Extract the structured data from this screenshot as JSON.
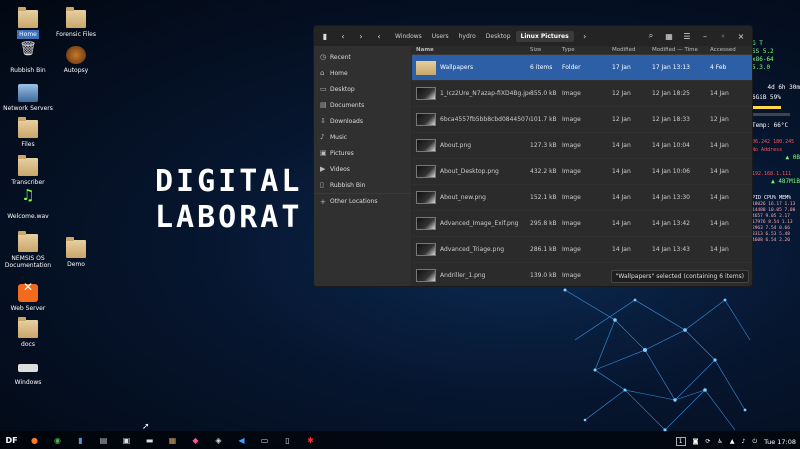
{
  "wallpaper": {
    "line1": "DIGITAL F",
    "line2": "LABORAT"
  },
  "desktop_icons": [
    {
      "label": "Home",
      "icon": "folder-icon",
      "selected": true
    },
    {
      "label": "Forensic Files",
      "icon": "folder-icon"
    },
    {
      "label": "Rubbish Bin",
      "icon": "trash-icon"
    },
    {
      "label": "Autopsy",
      "icon": "dog-icon"
    },
    {
      "label": "Network Servers",
      "icon": "network-icon"
    },
    {
      "label": "Files",
      "icon": "folder-icon"
    },
    {
      "label": "Transcriber",
      "icon": "folder-icon"
    },
    {
      "label": "Welcome.wav",
      "icon": "music-icon"
    },
    {
      "label": "NEMSIS OS Documentation",
      "icon": "folder-icon"
    },
    {
      "label": "Demo",
      "icon": "folder-icon"
    },
    {
      "label": "Web Server",
      "icon": "xampp-icon"
    },
    {
      "label": "docs",
      "icon": "folder-icon"
    },
    {
      "label": "Windows",
      "icon": "drive-icon"
    }
  ],
  "conky": {
    "l1": "G T",
    "l2": "SS 5.2",
    "l3": "x86-64",
    "l4": "5.3.0",
    "uptime": "4d 6h 30m",
    "ram": "6GiB 59%",
    "temp": "Temp: 66°C",
    "net_up_a": "06.242 180.245",
    "net_up_b": "No Address",
    "net_up_c": "▲ 0B",
    "net_dn_a": "192.168.1.111",
    "net_dn_b": "▲ 487MiB",
    "proc_header": "PID  CPU%  MEM%",
    "procs": [
      "18026 16.17 1.13",
      "14488 10.05 7.00",
      "4657  9.05 2.17",
      "17976 8.54 1.13",
      "2963  7.54 0.66",
      "3313  6.53 5.48",
      "4608  6.54 2.20"
    ]
  },
  "window": {
    "path": [
      "Windows",
      "Users",
      "hydro",
      "Desktop",
      "Linux Pictures"
    ],
    "sidebar": [
      {
        "label": "Recent",
        "icon": "clock-icon"
      },
      {
        "label": "Home",
        "icon": "home-icon"
      },
      {
        "label": "Desktop",
        "icon": "desktop-icon"
      },
      {
        "label": "Documents",
        "icon": "document-icon"
      },
      {
        "label": "Downloads",
        "icon": "download-icon"
      },
      {
        "label": "Music",
        "icon": "music-icon"
      },
      {
        "label": "Pictures",
        "icon": "picture-icon"
      },
      {
        "label": "Videos",
        "icon": "video-icon"
      },
      {
        "label": "Rubbish Bin",
        "icon": "trash-icon"
      },
      {
        "label": "Other Locations",
        "icon": "plus-icon"
      }
    ],
    "columns": {
      "name": "Name",
      "size": "Size",
      "type": "Type",
      "modified": "Modified",
      "modified_time": "Modified — Time",
      "accessed": "Accessed"
    },
    "files": [
      {
        "name": "Wallpapers",
        "size": "6 items",
        "type": "Folder",
        "modified": "17 Jan",
        "modified_time": "17 Jan 13:13",
        "accessed": "4 Feb",
        "folder": true,
        "selected": true
      },
      {
        "name": "1_Icz2Ure_N7azap-fiXD4Bg.jpeg",
        "size": "855.0 kB",
        "type": "Image",
        "modified": "12 Jan",
        "modified_time": "12 Jan 18:25",
        "accessed": "14 Jan"
      },
      {
        "name": "6bca4557fb5bb8cbd0844507d...",
        "size": "101.7 kB",
        "type": "Image",
        "modified": "12 Jan",
        "modified_time": "12 Jan 18:33",
        "accessed": "12 Jan"
      },
      {
        "name": "About.png",
        "size": "127.3 kB",
        "type": "Image",
        "modified": "14 Jan",
        "modified_time": "14 Jan 10:04",
        "accessed": "14 Jan"
      },
      {
        "name": "About_Desktop.png",
        "size": "432.2 kB",
        "type": "Image",
        "modified": "14 Jan",
        "modified_time": "14 Jan 10:06",
        "accessed": "14 Jan"
      },
      {
        "name": "About_new.png",
        "size": "152.1 kB",
        "type": "Image",
        "modified": "14 Jan",
        "modified_time": "14 Jan 13:30",
        "accessed": "14 Jan"
      },
      {
        "name": "Advanced_Image_Exif.png",
        "size": "295.8 kB",
        "type": "Image",
        "modified": "14 Jan",
        "modified_time": "14 Jan 13:42",
        "accessed": "14 Jan"
      },
      {
        "name": "Advanced_Triage.png",
        "size": "286.1 kB",
        "type": "Image",
        "modified": "14 Jan",
        "modified_time": "14 Jan 13:43",
        "accessed": "14 Jan"
      },
      {
        "name": "Andriller_1.png",
        "size": "139.0 kB",
        "type": "Image",
        "modified": "12 Jan",
        "modified_time": "12 Jan 12:35",
        "accessed": "14 Jan"
      }
    ],
    "status": "\"Wallpapers\" selected (containing 6 items)"
  },
  "dock": {
    "items": [
      {
        "name": "df-logo-icon",
        "glyph": "DF"
      },
      {
        "name": "firefox-icon",
        "glyph": "●"
      },
      {
        "name": "chrome-icon",
        "glyph": "◉"
      },
      {
        "name": "files-icon",
        "glyph": "▮"
      },
      {
        "name": "clipboard-icon",
        "glyph": "▤"
      },
      {
        "name": "terminal-icon",
        "glyph": "▣"
      },
      {
        "name": "drive-icon",
        "glyph": "▬"
      },
      {
        "name": "archive-icon",
        "glyph": "▦"
      },
      {
        "name": "cube-icon",
        "glyph": "◆"
      },
      {
        "name": "settings-icon",
        "glyph": "◈"
      },
      {
        "name": "vscode-icon",
        "glyph": "◀"
      },
      {
        "name": "text-editor-icon",
        "glyph": "▭"
      },
      {
        "name": "editor-icon",
        "glyph": "▯"
      },
      {
        "name": "bug-icon",
        "glyph": "✱"
      }
    ],
    "workspace": "1",
    "clock": "Tue 17:08"
  }
}
